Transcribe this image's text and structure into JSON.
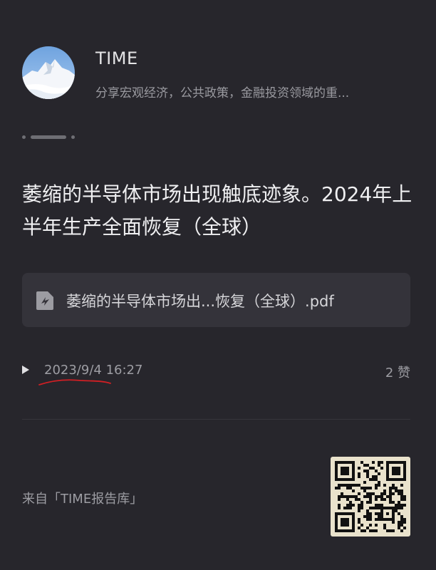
{
  "account": {
    "name": "TIME",
    "description": "分享宏观经济，公共政策，金融投资领域的重..."
  },
  "post": {
    "title": "萎缩的半导体市场出现触底迹象。2024年上半年生产全面恢复（全球）",
    "attachment": {
      "file_name": "萎缩的半导体市场出...恢复（全球）.pdf",
      "icon": "pdf-icon"
    },
    "date": "2023/9/4 16:27",
    "likes": "2 赞"
  },
  "footer": {
    "source": "来自「TIME报告库」",
    "qr_icon": "qr-code"
  },
  "colors": {
    "background": "#27262c",
    "card": "#34333a",
    "annotation": "#d11f24"
  }
}
